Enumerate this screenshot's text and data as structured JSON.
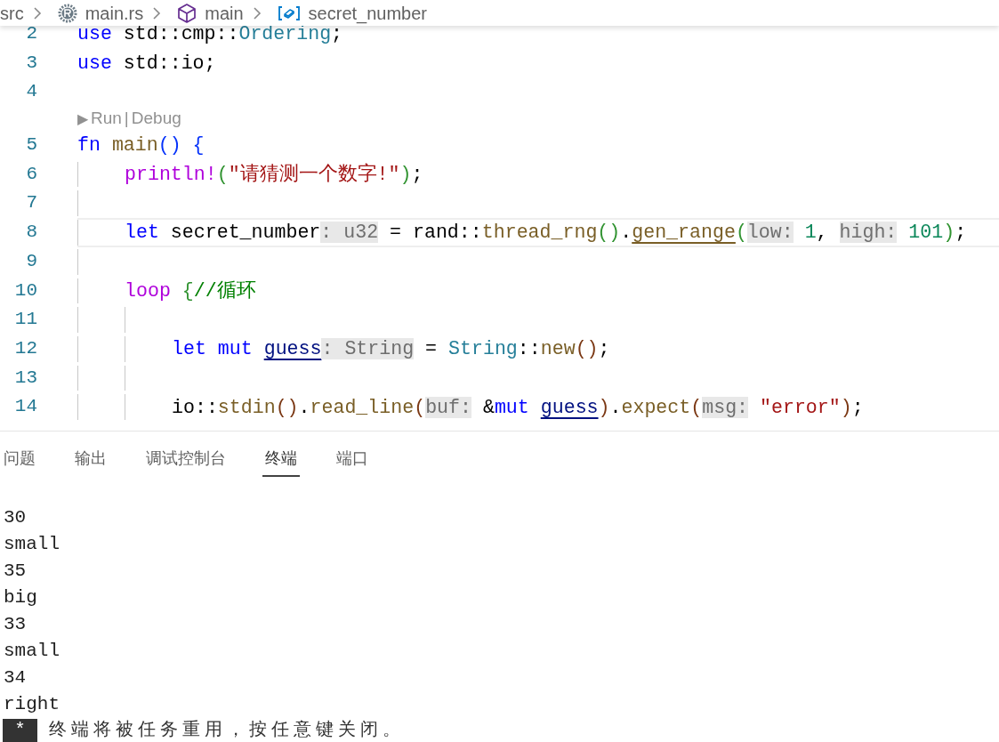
{
  "breadcrumbs": [
    {
      "label": "src",
      "kind": "folder"
    },
    {
      "label": "main.rs",
      "kind": "file"
    },
    {
      "label": "main",
      "kind": "module"
    },
    {
      "label": "secret_number",
      "kind": "variable"
    }
  ],
  "editor_lines": [
    {
      "kind": "code",
      "number": "2",
      "current": false,
      "tokens": [
        {
          "kind": "keyword",
          "text": "use"
        },
        {
          "kind": "plain",
          "text": " std::cmp::"
        },
        {
          "kind": "type",
          "text": "Ordering"
        },
        {
          "kind": "plain",
          "text": ";"
        }
      ]
    },
    {
      "kind": "code",
      "number": "3",
      "current": false,
      "tokens": [
        {
          "kind": "keyword",
          "text": "use"
        },
        {
          "kind": "plain",
          "text": " std::io;"
        }
      ]
    },
    {
      "kind": "code",
      "number": "4",
      "current": false
    },
    {
      "kind": "codelens",
      "play": "▶",
      "run": "Run",
      "separator": "|",
      "debug": "Debug"
    },
    {
      "kind": "code",
      "number": "5",
      "current": false,
      "tokens": [
        {
          "kind": "keyword",
          "text": "fn"
        },
        {
          "kind": "function",
          "text": " main"
        },
        {
          "kind": "bracket1",
          "text": "()"
        },
        {
          "kind": "bracket1",
          "text": " {"
        }
      ],
      "children": [
        {
          "kind": "code",
          "number": "6",
          "current": false,
          "tokens": [
            {
              "kind": "macro",
              "text": "println!"
            },
            {
              "kind": "bracket2",
              "text": "("
            },
            {
              "kind": "string",
              "text": "\"请猜测一个数字!\""
            },
            {
              "kind": "bracket2",
              "text": ")"
            },
            {
              "kind": "plain",
              "text": ";"
            }
          ]
        },
        {
          "kind": "code",
          "number": "7",
          "current": false
        },
        {
          "kind": "code",
          "number": "8",
          "current": true,
          "tokens": [
            {
              "kind": "keyword",
              "text": "let"
            },
            {
              "kind": "plain",
              "text": " secret_number"
            },
            {
              "kind": "hint",
              "text": ": u32"
            },
            {
              "kind": "plain",
              "text": " = rand::"
            },
            {
              "kind": "function",
              "text": "thread_rng"
            },
            {
              "kind": "bracket2",
              "text": "()"
            },
            {
              "kind": "plain",
              "text": "."
            },
            {
              "kind": "function",
              "text": "gen_range",
              "underlined": true
            },
            {
              "kind": "bracket2",
              "text": "("
            },
            {
              "kind": "hint",
              "text": "low:"
            },
            {
              "kind": "number",
              "text": " 1"
            },
            {
              "kind": "plain",
              "text": ", "
            },
            {
              "kind": "hint",
              "text": "high:"
            },
            {
              "kind": "number",
              "text": " 101"
            },
            {
              "kind": "bracket2",
              "text": ")"
            },
            {
              "kind": "plain",
              "text": ";"
            }
          ]
        },
        {
          "kind": "code",
          "number": "9",
          "current": false
        },
        {
          "kind": "code",
          "number": "10",
          "current": false,
          "tokens": [
            {
              "kind": "control",
              "text": "loop"
            },
            {
              "kind": "bracket2",
              "text": " {"
            },
            {
              "kind": "comment",
              "text": "//循环"
            }
          ],
          "children": [
            {
              "kind": "code",
              "number": "11",
              "current": false
            },
            {
              "kind": "code",
              "number": "12",
              "current": false,
              "tokens": [
                {
                  "kind": "keyword",
                  "text": "let"
                },
                {
                  "kind": "keyword",
                  "text": " mut "
                },
                {
                  "kind": "variable",
                  "text": "guess",
                  "underlined": true
                },
                {
                  "kind": "hint",
                  "text": ": String"
                },
                {
                  "kind": "plain",
                  "text": " = "
                },
                {
                  "kind": "type",
                  "text": "String"
                },
                {
                  "kind": "plain",
                  "text": "::"
                },
                {
                  "kind": "function",
                  "text": "new"
                },
                {
                  "kind": "bracket3",
                  "text": "()"
                },
                {
                  "kind": "plain",
                  "text": ";"
                }
              ]
            },
            {
              "kind": "code",
              "number": "13",
              "current": false
            },
            {
              "kind": "code",
              "number": "14",
              "current": false,
              "tokens": [
                {
                  "kind": "plain",
                  "text": "io::"
                },
                {
                  "kind": "function",
                  "text": "stdin"
                },
                {
                  "kind": "bracket3",
                  "text": "()"
                },
                {
                  "kind": "plain",
                  "text": "."
                },
                {
                  "kind": "function",
                  "text": "read_line"
                },
                {
                  "kind": "bracket3",
                  "text": "("
                },
                {
                  "kind": "hint",
                  "text": "buf:"
                },
                {
                  "kind": "plain",
                  "text": " &"
                },
                {
                  "kind": "keyword",
                  "text": "mut "
                },
                {
                  "kind": "variable",
                  "text": "guess",
                  "underlined": true
                },
                {
                  "kind": "bracket3",
                  "text": ")"
                },
                {
                  "kind": "plain",
                  "text": "."
                },
                {
                  "kind": "function",
                  "text": "expect"
                },
                {
                  "kind": "bracket3",
                  "text": "("
                },
                {
                  "kind": "hint",
                  "text": "msg:"
                },
                {
                  "kind": "string",
                  "text": " \"error\""
                },
                {
                  "kind": "bracket3",
                  "text": ")"
                },
                {
                  "kind": "plain",
                  "text": ";"
                }
              ]
            }
          ]
        }
      ]
    }
  ],
  "panel_tabs": [
    {
      "label": "问题",
      "selected": false
    },
    {
      "label": "输出",
      "selected": false
    },
    {
      "label": "调试控制台",
      "selected": false
    },
    {
      "label": "终端",
      "selected": true
    },
    {
      "label": "端口",
      "selected": false
    }
  ],
  "terminal": {
    "lines": [
      "30",
      "small",
      "35",
      "big",
      "33",
      "small",
      "34",
      "right"
    ],
    "task_message": {
      "badge": "*",
      "text": "终端将被任务重用，按任意键关闭。"
    }
  }
}
